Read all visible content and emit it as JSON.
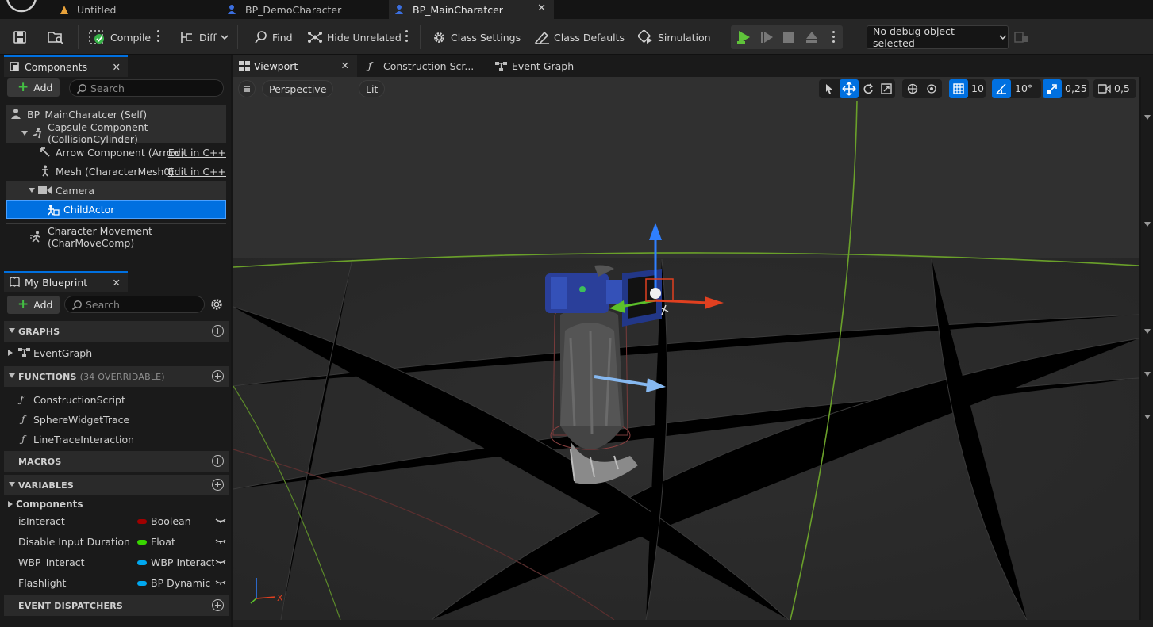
{
  "doc_tabs": [
    {
      "label": "Untitled"
    },
    {
      "label": "BP_DemoCharacter"
    },
    {
      "label": "BP_MainCharatcer",
      "active": true
    }
  ],
  "toolbar": {
    "compile": "Compile",
    "diff": "Diff",
    "find": "Find",
    "hide_unrelated": "Hide Unrelated",
    "class_settings": "Class Settings",
    "class_defaults": "Class Defaults",
    "simulation": "Simulation",
    "debug_object": "No debug object selected"
  },
  "components_panel": {
    "tab_label": "Components",
    "add_label": "Add",
    "search_placeholder": "Search",
    "items": [
      {
        "label": "BP_MainCharatcer (Self)"
      },
      {
        "label": "Capsule Component (CollisionCylinder)"
      },
      {
        "label": "Arrow Component (Arrow)",
        "action": "Edit in C++"
      },
      {
        "label": "Mesh (CharacterMesh0)",
        "action": "Edit in C++"
      },
      {
        "label": "Camera"
      },
      {
        "label": "ChildActor",
        "selected": true
      },
      {
        "label": "Character Movement (CharMoveComp)"
      }
    ]
  },
  "my_blueprint": {
    "tab_label": "My Blueprint",
    "add_label": "Add",
    "search_placeholder": "Search",
    "graphs": {
      "header": "GRAPHS",
      "items": [
        "EventGraph"
      ]
    },
    "functions": {
      "header": "FUNCTIONS",
      "sub": "(34 OVERRIDABLE)",
      "items": [
        "ConstructionScript",
        "SphereWidgetTrace",
        "LineTraceInteraction"
      ]
    },
    "macros": {
      "header": "MACROS"
    },
    "variables": {
      "header": "VARIABLES",
      "category": "Components",
      "items": [
        {
          "name": "isInteract",
          "type": "Boolean",
          "color": "#a00000"
        },
        {
          "name": "Disable Input Duration",
          "type": "Float",
          "color": "#38d500"
        },
        {
          "name": "WBP_Interact",
          "type": "WBP Interact",
          "color": "#00a8f0"
        },
        {
          "name": "Flashlight",
          "type": "BP Dynamic",
          "color": "#00a8f0"
        }
      ]
    },
    "event_dispatchers": {
      "header": "EVENT DISPATCHERS"
    }
  },
  "editor_tabs": [
    {
      "label": "Viewport",
      "active": true
    },
    {
      "label": "Construction Scr..."
    },
    {
      "label": "Event Graph"
    }
  ],
  "viewport": {
    "perspective": "Perspective",
    "lit": "Lit",
    "grid_snap": "10",
    "rotation_snap": "10°",
    "scale_snap": "0,25",
    "camera_speed": "0,5",
    "axis_x": "X",
    "accent": "#0070e0"
  }
}
